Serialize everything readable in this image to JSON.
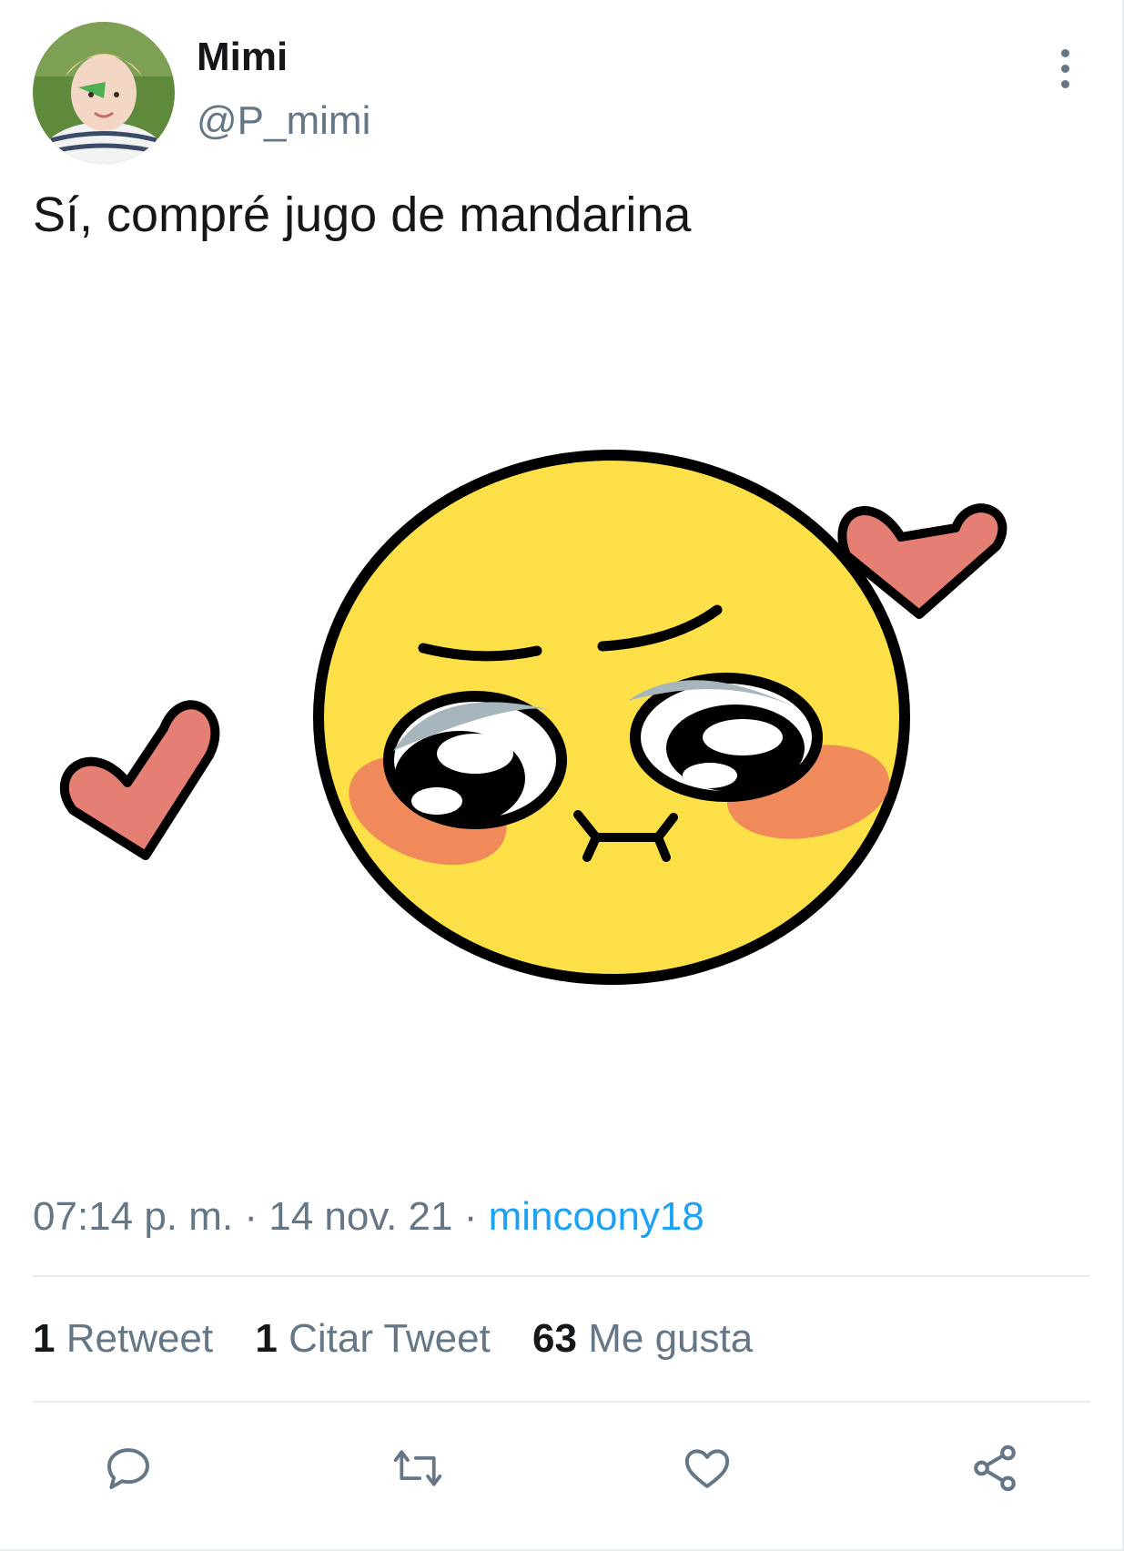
{
  "tweet": {
    "author": {
      "display_name": "Mimi",
      "handle": "@P_mimi"
    },
    "text": "Sí, compré jugo de mandarina",
    "meta": {
      "time": "07:14 p. m.",
      "date": "14 nov. 21",
      "separator": "·",
      "source": "mincoony18"
    },
    "stats": {
      "retweets_count": "1",
      "retweets_label": "Retweet",
      "quotes_count": "1",
      "quotes_label": "Citar Tweet",
      "likes_count": "63",
      "likes_label": "Me gusta"
    },
    "actions": [
      "reply-icon",
      "retweet-icon",
      "like-icon",
      "share-icon"
    ]
  },
  "colors": {
    "text_primary": "#14171a",
    "text_secondary": "#657786",
    "link": "#1da1f2",
    "divider": "#e6ecf0"
  }
}
